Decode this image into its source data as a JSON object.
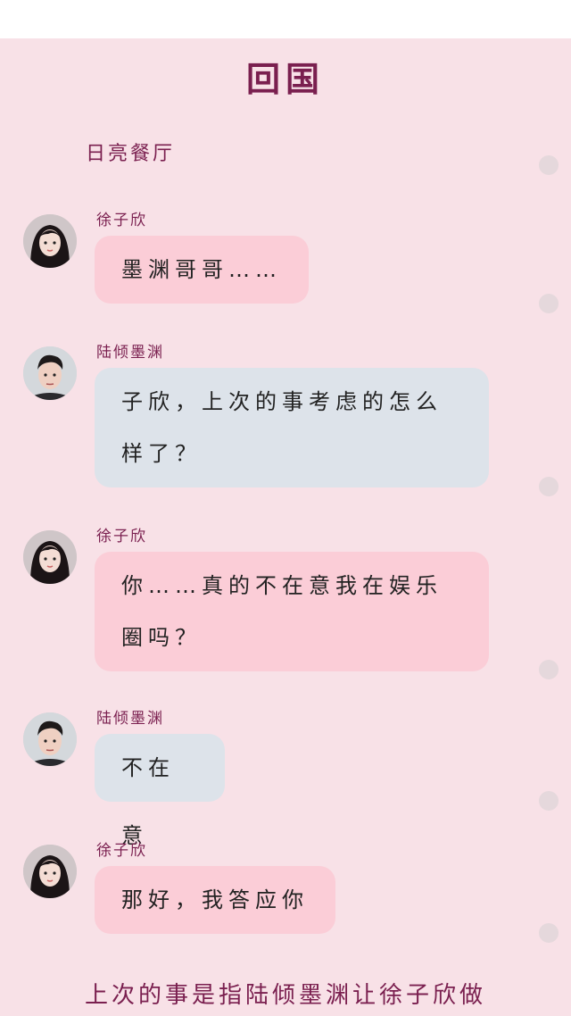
{
  "title": "回国",
  "scene": "日亮餐厅",
  "messages": [
    {
      "speaker": "徐子欣",
      "text": "墨渊哥哥……",
      "side": "female"
    },
    {
      "speaker": "陆倾墨渊",
      "text": "子欣，上次的事考虑的怎么样了？",
      "side": "male"
    },
    {
      "speaker": "徐子欣",
      "text": "你……真的不在意我在娱乐圈吗？",
      "side": "female"
    },
    {
      "speaker": "陆倾墨渊",
      "text": "不在意",
      "side": "male"
    },
    {
      "speaker": "徐子欣",
      "text": "那好，我答应你",
      "side": "female"
    }
  ],
  "footer_text": "上次的事是指陆倾墨渊让徐子欣做",
  "colors": {
    "background": "#f8e1e7",
    "accent": "#7a1f4f",
    "bubble_pink": "#fbcdd7",
    "bubble_blue": "#dde3ea"
  },
  "icons": [
    "scroll-dot-icon",
    "avatar-female-icon",
    "avatar-male-icon"
  ]
}
